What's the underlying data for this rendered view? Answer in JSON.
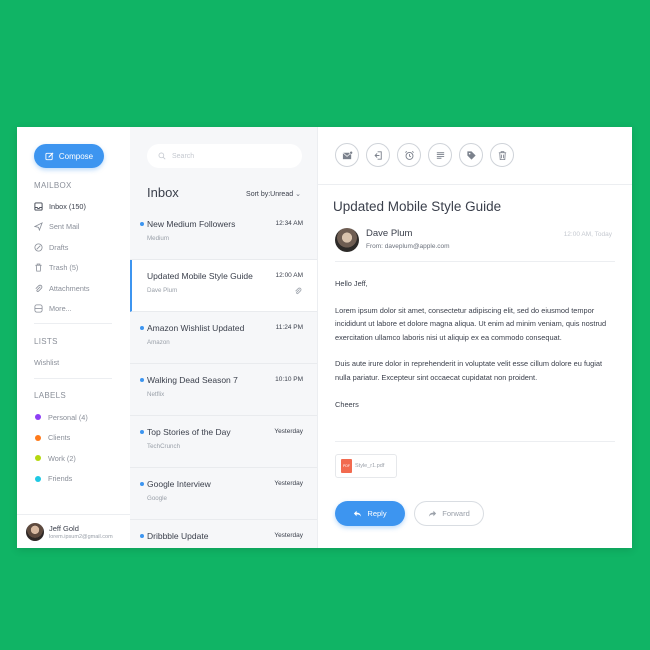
{
  "sidebar": {
    "compose_label": "Compose",
    "mailbox_title": "MAILBOX",
    "mailbox_items": [
      {
        "label": "Inbox (150)",
        "icon": "inbox-icon",
        "active": true
      },
      {
        "label": "Sent Mail",
        "icon": "send-icon",
        "active": false
      },
      {
        "label": "Drafts",
        "icon": "draft-icon",
        "active": false
      },
      {
        "label": "Trash (5)",
        "icon": "trash-icon",
        "active": false
      },
      {
        "label": "Attachments",
        "icon": "paperclip-icon",
        "active": false
      },
      {
        "label": "More...",
        "icon": "more-icon",
        "active": false
      }
    ],
    "lists_title": "LISTS",
    "lists_items": [
      {
        "label": "Wishlist"
      }
    ],
    "labels_title": "LABELS",
    "labels": [
      {
        "label": "Personal (4)",
        "color": "#8e3ff5"
      },
      {
        "label": "Clients",
        "color": "#ff7a1a"
      },
      {
        "label": "Work (2)",
        "color": "#b5d80f"
      },
      {
        "label": "Friends",
        "color": "#1fc8e3"
      }
    ],
    "user": {
      "name": "Jeff Gold",
      "email": "lorem.ipsum2@gmail.com"
    }
  },
  "list": {
    "search_placeholder": "Search",
    "title": "Inbox",
    "sort_label": "Sort by:Unread",
    "messages": [
      {
        "subject": "New Medium Followers",
        "from": "Medium",
        "time": "12:34 AM",
        "unread": true,
        "selected": false,
        "attachment": false
      },
      {
        "subject": "Updated Mobile Style Guide",
        "from": "Dave Plum",
        "time": "12:00 AM",
        "unread": false,
        "selected": true,
        "attachment": true
      },
      {
        "subject": "Amazon Wishlist Updated",
        "from": "Amazon",
        "time": "11:24 PM",
        "unread": true,
        "selected": false,
        "attachment": false
      },
      {
        "subject": "Walking Dead Season 7",
        "from": "Netflix",
        "time": "10:10 PM",
        "unread": true,
        "selected": false,
        "attachment": false
      },
      {
        "subject": "Top Stories of the Day",
        "from": "TechCrunch",
        "time": "Yesterday",
        "unread": true,
        "selected": false,
        "attachment": false
      },
      {
        "subject": "Google Interview",
        "from": "Google",
        "time": "Yesterday",
        "unread": true,
        "selected": false,
        "attachment": false
      },
      {
        "subject": "Dribbble Update",
        "from": "",
        "time": "Yesterday",
        "unread": true,
        "selected": false,
        "attachment": false
      }
    ]
  },
  "reader": {
    "toolbar_icons": [
      "mail-icon",
      "exit-icon",
      "alarm-icon",
      "list-icon",
      "tag-icon",
      "trash-icon"
    ],
    "subject": "Updated Mobile Style Guide",
    "sender_name": "Dave Plum",
    "sender_email": "From: daveplum@apple.com",
    "date": "12:00 AM, Today",
    "body": [
      "Hello Jeff,",
      "Lorem ipsum dolor sit amet, consectetur adipiscing elit, sed do eiusmod tempor incididunt ut labore et dolore magna aliqua. Ut enim ad minim veniam, quis nostrud exercitation ullamco laboris nisi ut aliquip ex ea commodo consequat.",
      "Duis aute irure dolor in reprehenderit in voluptate velit esse cillum dolore eu fugiat nulla pariatur. Excepteur sint occaecat cupidatat non proident.",
      "Cheers"
    ],
    "attachment_name": "Style_r1.pdf",
    "attachment_type": "PDF",
    "reply_label": "Reply",
    "forward_label": "Forward"
  },
  "colors": {
    "background": "#10b465",
    "accent": "#3d95f0"
  }
}
